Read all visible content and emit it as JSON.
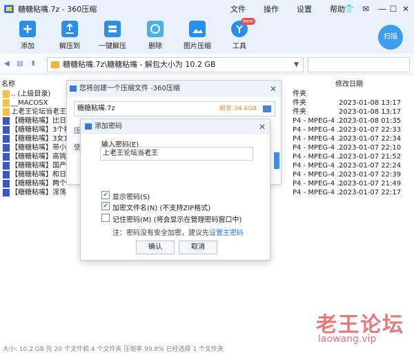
{
  "window": {
    "title": "糖糖粘嘴.7z - 360压缩",
    "menu": [
      "文件",
      "操作",
      "设置",
      "帮助"
    ],
    "controls": [
      "tshirt-icon",
      "mail-icon",
      "minimize",
      "maximize",
      "close"
    ]
  },
  "toolbar": {
    "items": [
      {
        "label": "添加",
        "icon": "add-icon"
      },
      {
        "label": "解压到",
        "icon": "extract-to-icon"
      },
      {
        "label": "一键解压",
        "icon": "one-click-extract-icon"
      },
      {
        "label": "删除",
        "icon": "delete-icon"
      },
      {
        "label": "图片压缩",
        "icon": "image-compress-icon"
      },
      {
        "label": "工具",
        "icon": "tools-icon",
        "badge": "New"
      }
    ],
    "scan_label": "扫描"
  },
  "address": {
    "path": "糖糖粘嘴.7z\\糖糖粘嘴 - 解包大小为 10.2 GB",
    "search_placeholder": ""
  },
  "list": {
    "header": {
      "name": "名称",
      "type": "件夹",
      "date": "修改日期"
    },
    "rows": [
      {
        "name": ".. (上级目录)",
        "type": "件夹",
        "date": "",
        "icon": "up-folder-icon"
      },
      {
        "name": "__MACOSX",
        "type": "件夹",
        "date": "2023-01-08 13:17",
        "icon": "folder-icon"
      },
      {
        "name": "上老王论坛当老王",
        "type": "件夹",
        "date": "2023-01-08 13:17",
        "icon": "folder-icon"
      },
      {
        "name": "【糖糖粘嘴】比日",
        "type": "P4 - MPEG-4 ...",
        "date": "2023-01-08 01:35",
        "icon": "video-icon"
      },
      {
        "name": "【糖糖粘嘴】3个视",
        "type": "P4 - MPEG-4 ...",
        "date": "2023-01-07 22:33",
        "icon": "video-icon"
      },
      {
        "name": "【糖糖粘嘴】3女1",
        "type": "P4 - MPEG-4 ...",
        "date": "2023-01-07 22:34",
        "icon": "video-icon"
      },
      {
        "name": "【糖糖粘嘴】带小",
        "type": "P4 - MPEG-4 ...",
        "date": "2023-01-07 22:10",
        "icon": "video-icon"
      },
      {
        "name": "【糖糖粘嘴】高挑",
        "type": "P4 - MPEG-4 ...",
        "date": "2023-01-07 21:52",
        "icon": "video-icon"
      },
      {
        "name": "【糖糖粘嘴】国产",
        "type": "P4 - MPEG-4 ...",
        "date": "2023-01-07 22:24",
        "icon": "video-icon"
      },
      {
        "name": "【糖糖粘嘴】和日",
        "type": "P4 - MPEG-4 ...",
        "date": "2023-01-07 22:39",
        "icon": "video-icon"
      },
      {
        "name": "【糖糖粘嘴】两个",
        "type": "P4 - MPEG-4 ...",
        "date": "2023-01-07 21:49",
        "icon": "video-icon"
      },
      {
        "name": "【糖糖粘嘴】淫荡",
        "type": "P4 - MPEG-4 ...",
        "date": "2023-01-07 22:17",
        "icon": "video-icon"
      }
    ]
  },
  "status": "大小: 10.2 GB 共 20 个文件和 4 个文件夹 压缩率 99.8% 已经选择 1 个文件夹",
  "watermark": {
    "line1": "老王论坛",
    "line2": "laowang.vip"
  },
  "create_dialog": {
    "title": "您将创建一个压缩文件 -360压缩",
    "filename": "糖糖粘嘴.7z",
    "remaining": "剩余:34.4GB",
    "side_labels": [
      "压",
      "使"
    ]
  },
  "password_dialog": {
    "title": "添加密码",
    "input_label": "输入密码(E)",
    "password_value": "上老王论坛当老王",
    "options": [
      {
        "label": "显示密码(S)",
        "checked": true
      },
      {
        "label": "加密文件名(N) (不支持ZIP格式)",
        "checked": true
      },
      {
        "label": "记住密码(M) (将会显示在管理密码窗口中)",
        "checked": false
      }
    ],
    "note": "注：密码没有安全加密，建议先",
    "note_link": "设置主密码",
    "ok": "确认",
    "cancel": "取消"
  }
}
